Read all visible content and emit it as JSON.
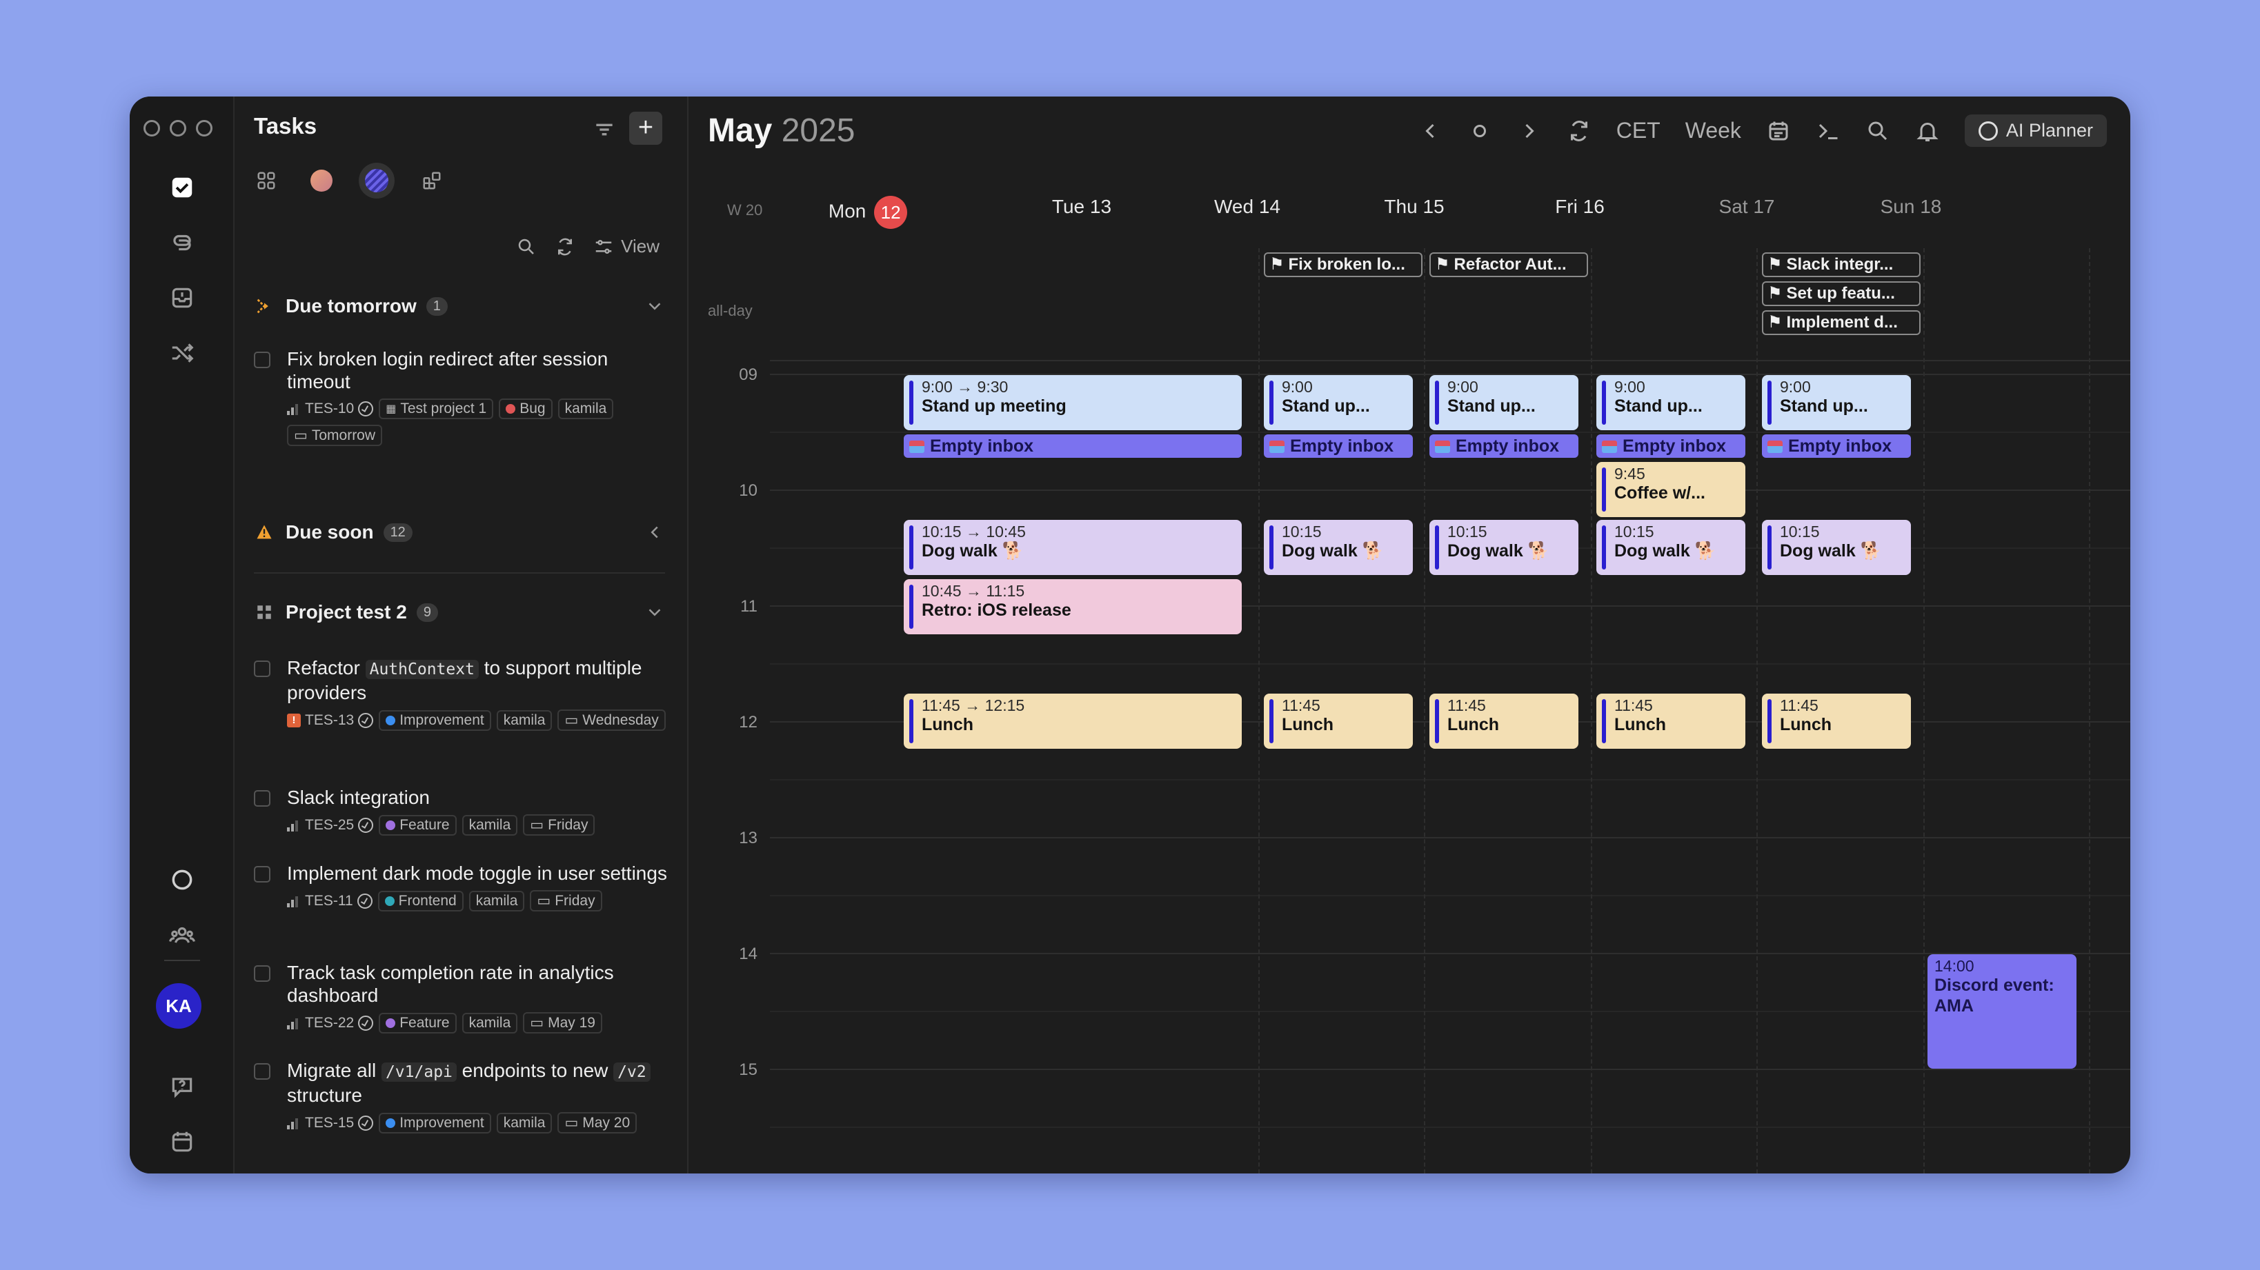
{
  "sidebar_rail": {
    "avatar_initials": "KA"
  },
  "tasks_panel": {
    "title": "Tasks",
    "view_label": "View",
    "sections": {
      "due_tomorrow": {
        "label": "Due tomorrow",
        "count": "1"
      },
      "due_soon": {
        "label": "Due soon",
        "count": "12"
      },
      "project": {
        "label": "Project test 2",
        "count": "9"
      }
    },
    "tasks": [
      {
        "title": "Fix broken login redirect after session timeout",
        "id": "TES-10",
        "project": "Test project 1",
        "label": "Bug",
        "label_color": "#e05555",
        "assignee": "kamila",
        "due": "Tomorrow"
      },
      {
        "title_parts": [
          "Refactor",
          "AuthContext",
          "to support multiple providers"
        ],
        "id": "TES-13",
        "label": "Improvement",
        "label_color": "#3b8ef0",
        "assignee": "kamila",
        "due": "Wednesday"
      },
      {
        "title": "Slack integration",
        "id": "TES-25",
        "label": "Feature",
        "label_color": "#a070e0",
        "assignee": "kamila",
        "due": "Friday"
      },
      {
        "title": "Implement dark mode toggle in user settings",
        "id": "TES-11",
        "label": "Frontend",
        "label_color": "#2fa8b8",
        "assignee": "kamila",
        "due": "Friday"
      },
      {
        "title": "Track task completion rate in analytics dashboard",
        "id": "TES-22",
        "label": "Feature",
        "label_color": "#a070e0",
        "assignee": "kamila",
        "due": "May 19"
      },
      {
        "title_parts": [
          "Migrate all",
          "/v1/api",
          "endpoints to new",
          "/v2",
          "structure"
        ],
        "id": "TES-15",
        "label": "Improvement",
        "label_color": "#3b8ef0",
        "assignee": "kamila",
        "due": "May 20"
      }
    ]
  },
  "calendar": {
    "month": "May",
    "year": "2025",
    "timezone": "CET",
    "view_mode": "Week",
    "ai_button": "AI Planner",
    "week_label": "W 20",
    "allday_label": "all-day",
    "days": [
      {
        "name": "Mon",
        "num": "12",
        "today": true
      },
      {
        "name": "Tue",
        "num": "13"
      },
      {
        "name": "Wed",
        "num": "14"
      },
      {
        "name": "Thu",
        "num": "15"
      },
      {
        "name": "Fri",
        "num": "16"
      },
      {
        "name": "Sat",
        "num": "17"
      },
      {
        "name": "Sun",
        "num": "18"
      }
    ],
    "hours": [
      "09",
      "10",
      "11",
      "12",
      "13",
      "14",
      "15"
    ],
    "allday_events": {
      "tue": "Fix broken lo...",
      "wed": "Refactor Aut...",
      "fri_1": "Slack integr...",
      "fri_2": "Set up featu...",
      "fri_3": "Implement d..."
    },
    "events": {
      "mon_standup": {
        "time": "9:00 → 9:30",
        "name": "Stand up meeting"
      },
      "mon_inbox": "Empty inbox",
      "mon_dog": {
        "time": "10:15 → 10:45",
        "name": "Dog walk 🐕"
      },
      "mon_retro": {
        "time": "10:45 → 11:15",
        "name": "Retro: iOS release"
      },
      "mon_lunch": {
        "time": "11:45 → 12:15",
        "name": "Lunch"
      },
      "tue_standup": {
        "time": "9:00",
        "name": "Stand up..."
      },
      "tue_inbox": "Empty inbox",
      "tue_dog": {
        "time": "10:15",
        "name": "Dog walk 🐕"
      },
      "tue_lunch": {
        "time": "11:45",
        "name": "Lunch"
      },
      "wed_standup": {
        "time": "9:00",
        "name": "Stand up..."
      },
      "wed_inbox": "Empty inbox",
      "wed_dog": {
        "time": "10:15",
        "name": "Dog walk 🐕"
      },
      "wed_lunch": {
        "time": "11:45",
        "name": "Lunch"
      },
      "thu_standup": {
        "time": "9:00",
        "name": "Stand up..."
      },
      "thu_inbox": "Empty inbox",
      "thu_coffee": {
        "time": "9:45",
        "name": "Coffee w/..."
      },
      "thu_dog": {
        "time": "10:15",
        "name": "Dog walk 🐕"
      },
      "thu_lunch": {
        "time": "11:45",
        "name": "Lunch"
      },
      "fri_standup": {
        "time": "9:00",
        "name": "Stand up..."
      },
      "fri_inbox": "Empty inbox",
      "fri_dog": {
        "time": "10:15",
        "name": "Dog walk 🐕"
      },
      "fri_lunch": {
        "time": "11:45",
        "name": "Lunch"
      },
      "sat_discord": {
        "time": "14:00",
        "name": "Discord event: AMA"
      }
    }
  },
  "colors": {
    "background": "#8ea3ee",
    "window": "#1d1d1d",
    "today_badge": "#e64b4b",
    "event_blue": "#cfe0f8",
    "event_violet": "#dccff2",
    "event_pink": "#f1c9dc",
    "event_amber": "#f3dfb4",
    "inbox": "#7b72ef",
    "avatar": "#2a23c8"
  }
}
